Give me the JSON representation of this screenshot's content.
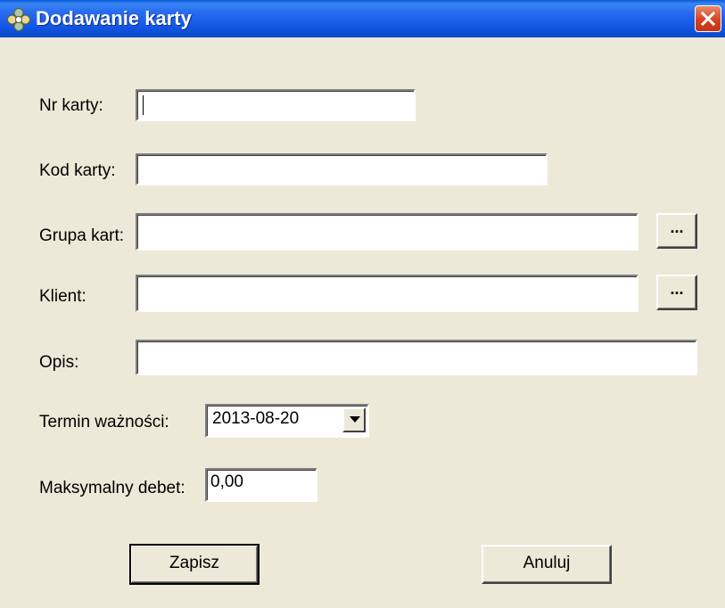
{
  "window": {
    "title": "Dodawanie karty",
    "icon": "app-cluster-icon",
    "close_icon": "close-icon"
  },
  "form": {
    "card_number": {
      "label": "Nr karty:",
      "value": ""
    },
    "card_code": {
      "label": "Kod karty:",
      "value": ""
    },
    "card_group": {
      "label": "Grupa kart:",
      "value": "",
      "browse_label": "..."
    },
    "client": {
      "label": "Klient:",
      "value": "",
      "browse_label": "..."
    },
    "description": {
      "label": "Opis:",
      "value": ""
    },
    "expiry": {
      "label": "Termin ważności:",
      "value": "2013-08-20"
    },
    "max_debit": {
      "label": "Maksymalny debet:",
      "value": "0,00"
    }
  },
  "buttons": {
    "save_label": "Zapisz",
    "cancel_label": "Anuluj"
  },
  "colors": {
    "titlebar": "#2a6ef0",
    "background": "#ece9d8",
    "close": "#d6421e"
  }
}
